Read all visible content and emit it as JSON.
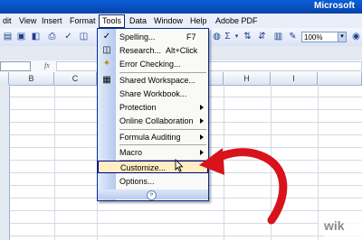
{
  "window": {
    "title": "Microsoft"
  },
  "menubar": {
    "items": [
      {
        "label": "dit"
      },
      {
        "label": "View"
      },
      {
        "label": "Insert"
      },
      {
        "label": "Format"
      },
      {
        "label": "Tools"
      },
      {
        "label": "Data"
      },
      {
        "label": "Window"
      },
      {
        "label": "Help"
      },
      {
        "label": "Adobe PDF"
      }
    ]
  },
  "toolbar": {
    "zoom_value": "100%",
    "sigma": "Σ"
  },
  "formula_bar": {
    "fx_label": "fx"
  },
  "columns": [
    "B",
    "C",
    "H",
    "I"
  ],
  "tools_menu": {
    "items": [
      {
        "label": "Spelling...",
        "shortcut": "F7",
        "icon": "spelling-icon"
      },
      {
        "label": "Research...",
        "shortcut": "Alt+Click",
        "icon": "research-icon"
      },
      {
        "label": "Error Checking...",
        "icon": "error-checking-icon"
      },
      {
        "label": "Shared Workspace...",
        "icon": "shared-workspace-icon"
      },
      {
        "label": "Share Workbook..."
      },
      {
        "label": "Protection",
        "submenu": true
      },
      {
        "label": "Online Collaboration",
        "submenu": true
      },
      {
        "label": "Formula Auditing",
        "submenu": true
      },
      {
        "label": "Macro",
        "submenu": true
      },
      {
        "label": "Customize...",
        "highlighted": true
      },
      {
        "label": "Options..."
      }
    ],
    "expand_icon": "double-chevron-down-icon"
  },
  "annotation": {
    "arrow_color": "#d9121b",
    "cursor_icon": "mouse-pointer-icon"
  },
  "watermark": {
    "text": "wik"
  }
}
